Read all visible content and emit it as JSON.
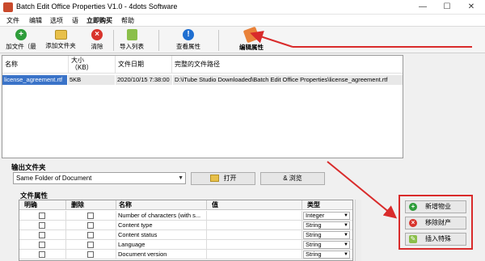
{
  "window": {
    "title": "Batch Edit Office Properties V1.0 - 4dots Software",
    "min": "—",
    "max": "☐",
    "close": "✕"
  },
  "menu": [
    "文件",
    "编辑",
    "选项",
    "语",
    "立即购买",
    "帮助"
  ],
  "toolbar": {
    "add_file": "加文件（最",
    "add_folder": "添加文件夹",
    "clear": "清除",
    "import_list": "导入列表",
    "view_properties": "查看属性",
    "edit_properties": "编辑属性"
  },
  "file_list": {
    "columns": [
      "名称",
      "大小\n（KB）",
      "文件日期",
      "完整的文件路径"
    ],
    "rows": [
      {
        "name": "license_agreement.rtf",
        "size": "5KB",
        "date": "2020/10/15 7:38:00",
        "path": "D:\\iTube Studio Downloaded\\Batch Edit Office Properties\\license_agreement.rtf"
      }
    ]
  },
  "output": {
    "title": "输出文件夹",
    "folder_value": "Same Folder of Document",
    "open_label": "打开",
    "browse_label": "& 浏览"
  },
  "properties": {
    "title": "文件属性",
    "columns": [
      "明确",
      "删除",
      "名称",
      "值",
      "类型"
    ],
    "rows": [
      {
        "name": "Number of characters (with s...",
        "value": "",
        "type": "Integer"
      },
      {
        "name": "Content type",
        "value": "",
        "type": "String"
      },
      {
        "name": "Content status",
        "value": "",
        "type": "String"
      },
      {
        "name": "Language",
        "value": "",
        "type": "String"
      },
      {
        "name": "Document version",
        "value": "",
        "type": "String"
      }
    ]
  },
  "side_buttons": {
    "add_property": "新增物业",
    "remove_property": "移除财产",
    "insert_special": "插入特殊"
  },
  "colors": {
    "highlight": "#d92b2b",
    "selection": "#3a73c8"
  }
}
